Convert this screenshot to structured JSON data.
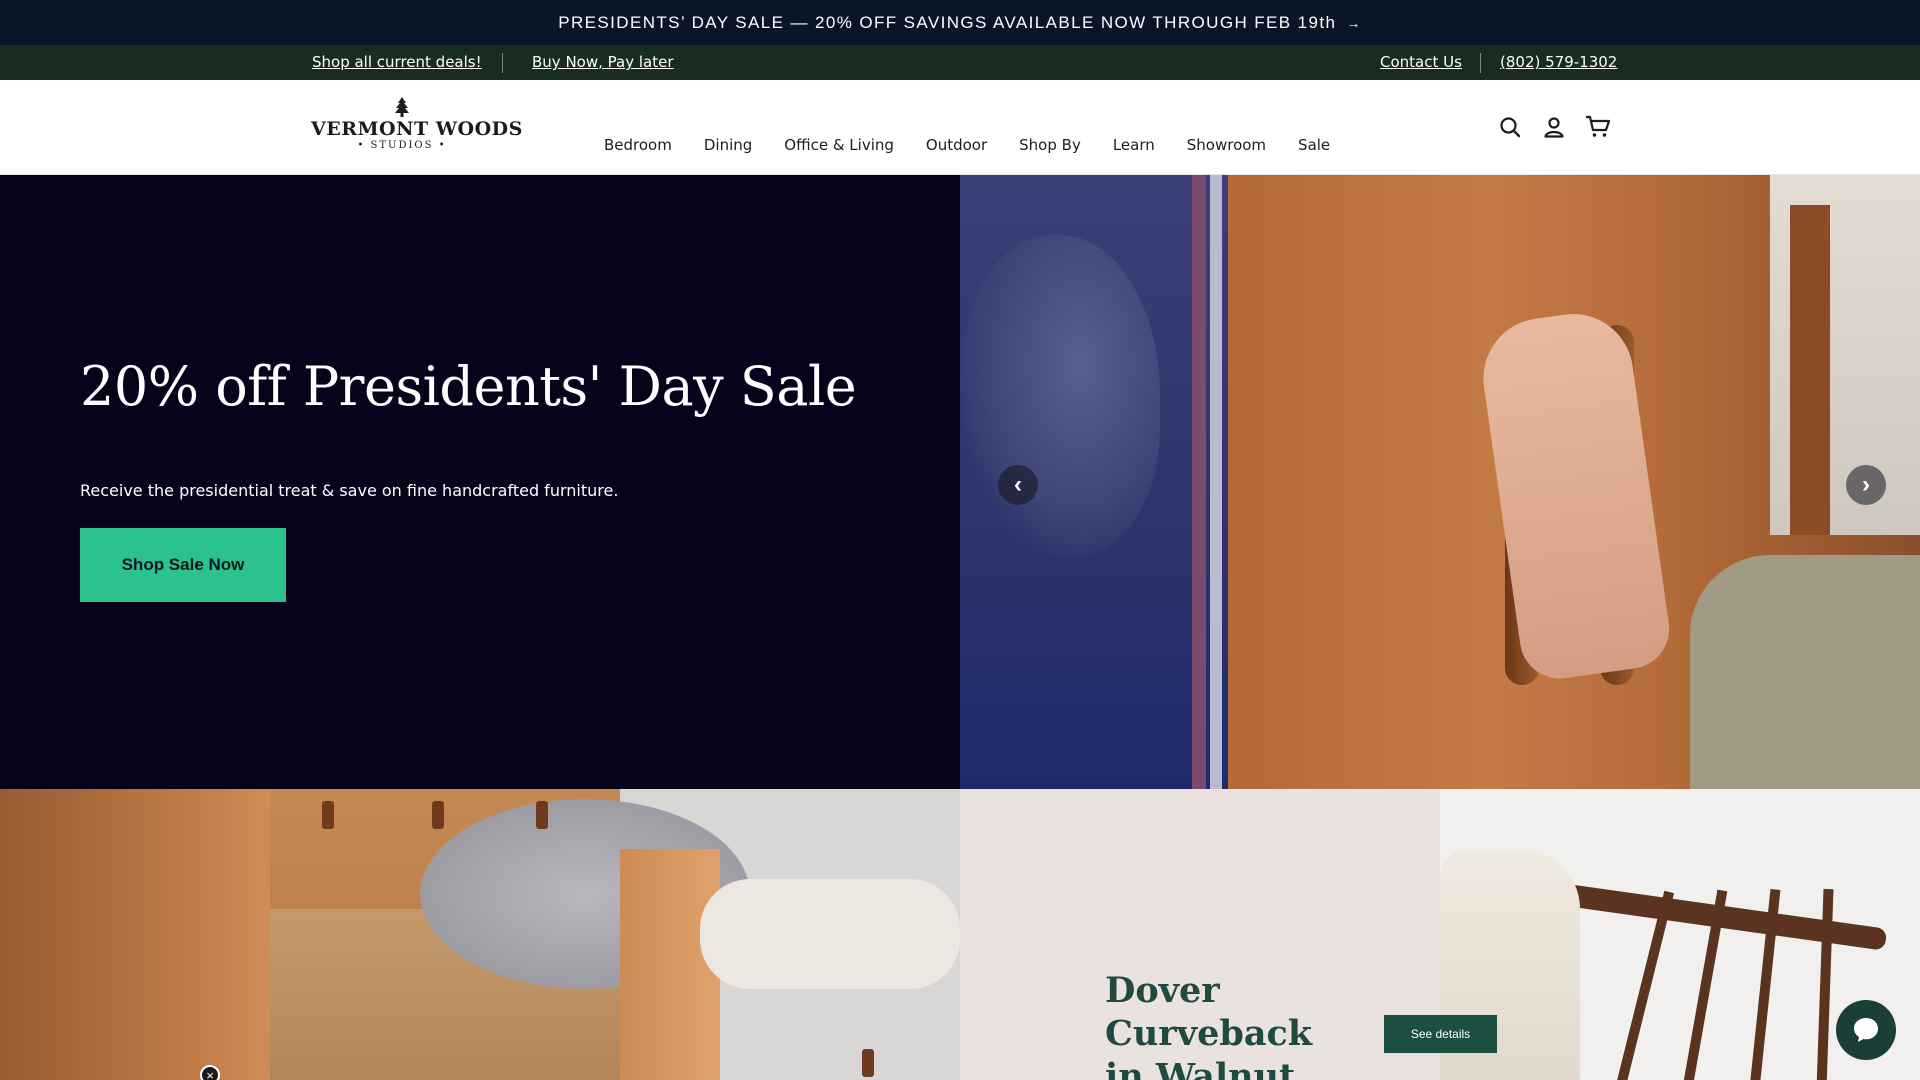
{
  "announcement": {
    "text": "PRESIDENTS’ DAY SALE — 20% OFF SAVINGS AVAILABLE NOW THROUGH FEB 19th",
    "arrow": "→"
  },
  "utility": {
    "shop_deals": "Shop all current deals!",
    "buy_now": "Buy Now, Pay later",
    "contact": "Contact Us",
    "phone": "(802) 579-1302"
  },
  "logo": {
    "name": "VERMONT WOODS",
    "sub": "• STUDIOS •"
  },
  "nav": {
    "items": [
      "Bedroom",
      "Dining",
      "Office & Living",
      "Outdoor",
      "Shop By",
      "Learn",
      "Showroom",
      "Sale"
    ]
  },
  "header_icons": [
    "search-icon",
    "account-icon",
    "cart-icon"
  ],
  "hero": {
    "title": "20% off Presidents' Day Sale",
    "text": "Receive the presidential treat & save on fine handcrafted furniture.",
    "button": "Shop Sale Now",
    "prev": "‹",
    "next": "›"
  },
  "promo": {
    "title": "Dover Curveback in Walnut",
    "button": "See details"
  },
  "close": "×",
  "colors": {
    "announce_bg": "#0a1628",
    "utility_bg": "#1a2b22",
    "hero_bg": "#06041b",
    "accent": "#2cc28e",
    "promo_bg": "#e9e2df",
    "promo_text": "#1e4a3f",
    "chat_bg": "#1a3f36"
  }
}
